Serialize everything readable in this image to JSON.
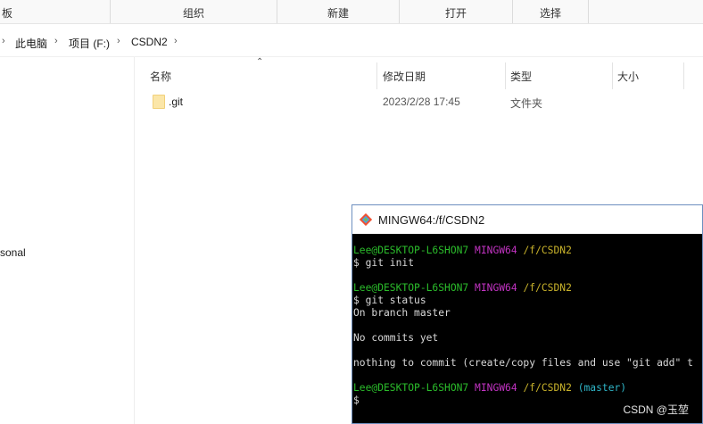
{
  "ribbon": {
    "groups": [
      "板",
      "组织",
      "新建",
      "打开",
      "选择"
    ]
  },
  "breadcrumb": {
    "items": [
      "此电脑",
      "项目 (F:)",
      "CSDN2"
    ]
  },
  "nav": {
    "partial_item": "sonal"
  },
  "columns": {
    "name": "名称",
    "modified": "修改日期",
    "type": "类型",
    "size": "大小"
  },
  "files": [
    {
      "name": ".git",
      "modified": "2023/2/28 17:45",
      "type": "文件夹"
    }
  ],
  "terminal": {
    "title": "MINGW64:/f/CSDN2",
    "prompt1": {
      "user": "Lee@DESKTOP-L6SHON7",
      "env": "MINGW64",
      "path": "/f/CSDN2"
    },
    "cmd1": "$ git init",
    "prompt2": {
      "user": "Lee@DESKTOP-L6SHON7",
      "env": "MINGW64",
      "path": "/f/CSDN2"
    },
    "cmd2": "$ git status",
    "out1": "On branch master",
    "out2": "No commits yet",
    "out3": "nothing to commit (create/copy files and use \"git add\" t",
    "prompt3": {
      "user": "Lee@DESKTOP-L6SHON7",
      "env": "MINGW64",
      "path": "/f/CSDN2",
      "branch": "(master)"
    },
    "cursor_line": "$"
  },
  "watermark": "CSDN @玉堃",
  "colors": {
    "prompt_user": "#2bbd2b",
    "prompt_env": "#c233c2",
    "prompt_path": "#c8b22b",
    "prompt_branch": "#2fb6c8"
  }
}
